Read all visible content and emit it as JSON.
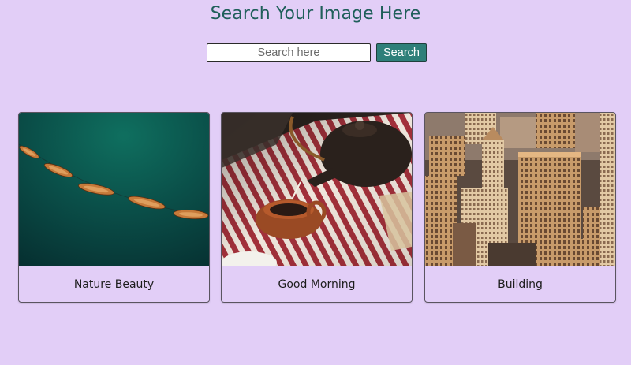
{
  "header": {
    "title": "Search Your Image Here"
  },
  "search": {
    "placeholder": "Search here",
    "value": "",
    "button_label": "Search"
  },
  "gallery": {
    "cards": [
      {
        "caption": "Nature Beauty",
        "image": "boats-on-teal-water"
      },
      {
        "caption": "Good Morning",
        "image": "teapot-pouring-tea"
      },
      {
        "caption": "Building",
        "image": "city-buildings-aerial"
      }
    ]
  },
  "colors": {
    "background": "#e2cef7",
    "title": "#1f5f5a",
    "button": "#2e7f79"
  }
}
